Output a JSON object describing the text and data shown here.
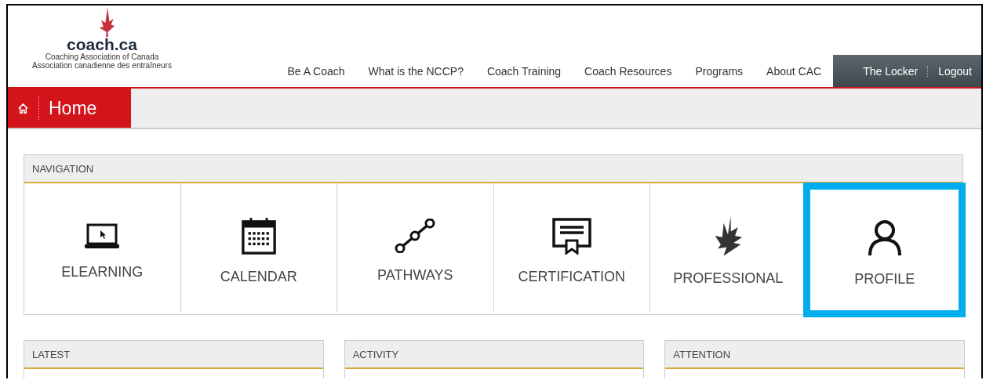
{
  "logo": {
    "wordmark": "coach.ca",
    "subtitle_en": "Coaching Association of Canada",
    "subtitle_fr": "Association canadienne des entraîneurs"
  },
  "main_nav": [
    {
      "label": "Be A Coach"
    },
    {
      "label": "What is the NCCP?"
    },
    {
      "label": "Coach Training"
    },
    {
      "label": "Coach Resources"
    },
    {
      "label": "Programs"
    },
    {
      "label": "About CAC"
    }
  ],
  "account_nav": [
    {
      "label": "The Locker"
    },
    {
      "label": "Logout"
    }
  ],
  "breadcrumb": {
    "title": "Home"
  },
  "navigation": {
    "title": "NAVIGATION",
    "tiles": [
      {
        "label": "ELEARNING",
        "kind": "laptop",
        "highlighted": false
      },
      {
        "label": "CALENDAR",
        "kind": "calendar",
        "highlighted": false
      },
      {
        "label": "PATHWAYS",
        "kind": "pathway",
        "highlighted": false
      },
      {
        "label": "CERTIFICATION",
        "kind": "certificate",
        "highlighted": false
      },
      {
        "label": "PROFESSIONAL",
        "kind": "leaf",
        "highlighted": false
      },
      {
        "label": "PROFILE",
        "kind": "person",
        "highlighted": true
      }
    ]
  },
  "panels": [
    {
      "title": "LATEST"
    },
    {
      "title": "ACTIVITY"
    },
    {
      "title": "ATTENTION"
    }
  ]
}
